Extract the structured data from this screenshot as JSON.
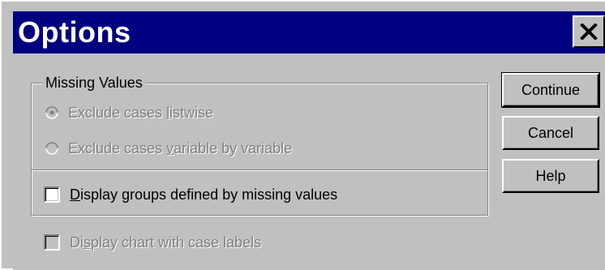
{
  "dialog": {
    "title": "Options"
  },
  "missing_values": {
    "legend": "Missing Values",
    "options": [
      {
        "pre": "Exclude cases ",
        "hot": "l",
        "post": "istwise",
        "selected": true,
        "enabled": false
      },
      {
        "pre": "Exclude cases ",
        "hot": "v",
        "post": "ariable by variable",
        "selected": false,
        "enabled": false
      }
    ],
    "display_groups": {
      "pre": "",
      "hot": "D",
      "post": "isplay groups defined by missing values",
      "checked": false,
      "enabled": true
    }
  },
  "display_chart": {
    "pre": "Di",
    "hot": "s",
    "post": "play chart with case labels",
    "checked": false,
    "enabled": false
  },
  "buttons": {
    "continue": "Continue",
    "cancel": "Cancel",
    "help": "Help"
  },
  "icons": {
    "close": "close-icon"
  },
  "colors": {
    "titlebar": "#000080",
    "face": "#c0c0c0"
  }
}
